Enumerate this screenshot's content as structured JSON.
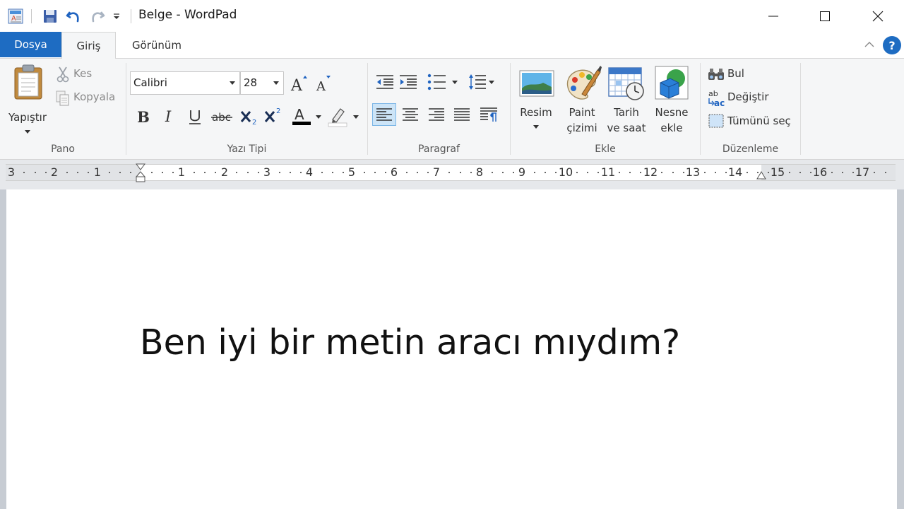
{
  "window": {
    "title": "Belge - WordPad"
  },
  "tabs": {
    "file": "Dosya",
    "home": "Giriş",
    "view": "Görünüm",
    "help": "?"
  },
  "ribbon": {
    "clipboard": {
      "group_label": "Pano",
      "paste": "Yapıştır",
      "cut": "Kes",
      "copy": "Kopyala"
    },
    "font": {
      "group_label": "Yazı Tipi",
      "family": "Calibri",
      "size": "28"
    },
    "paragraph": {
      "group_label": "Paragraf"
    },
    "insert": {
      "group_label": "Ekle",
      "picture": "Resim",
      "paint_line1": "Paint",
      "paint_line2": "çizimi",
      "datetime_line1": "Tarih",
      "datetime_line2": "ve saat",
      "object_line1": "Nesne",
      "object_line2": "ekle"
    },
    "editing": {
      "group_label": "Düzenleme",
      "find": "Bul",
      "replace": "Değiştir",
      "select_all": "Tümünü seç"
    }
  },
  "ruler": {
    "numbers_left": [
      "3",
      "2",
      "1"
    ],
    "numbers_right": [
      "1",
      "2",
      "3",
      "4",
      "5",
      "6",
      "7",
      "8",
      "9",
      "10",
      "11",
      "12",
      "13",
      "14",
      "15",
      "16",
      "17"
    ]
  },
  "document": {
    "text": "Ben iyi bir metin aracı mıydım?"
  },
  "colors": {
    "accent": "#1e6cc2",
    "ribbon_bg": "#f5f6f7",
    "font_color_bar": "#000000",
    "highlight_bar": "#ffffff"
  }
}
